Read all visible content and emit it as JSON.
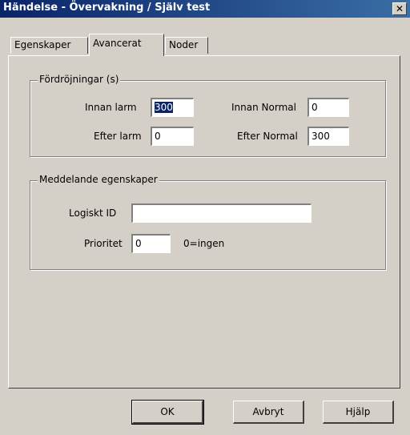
{
  "window": {
    "title": "Händelse - Övervakning / Själv test",
    "close_glyph": "✕"
  },
  "tabs": [
    {
      "label": "Egenskaper"
    },
    {
      "label": "Avancerat",
      "active": true
    },
    {
      "label": "Noder"
    }
  ],
  "delays": {
    "title": "Fördröjningar (s)",
    "before_alarm_label": "Innan larm",
    "before_alarm_value": "300",
    "after_alarm_label": "Efter larm",
    "after_alarm_value": "0",
    "before_normal_label": "Innan Normal",
    "before_normal_value": "0",
    "after_normal_label": "Efter Normal",
    "after_normal_value": "300"
  },
  "message": {
    "title": "Meddelande egenskaper",
    "logical_id_label": "Logiskt ID",
    "logical_id_value": "",
    "priority_label": "Prioritet",
    "priority_value": "0",
    "priority_hint": "0=ingen"
  },
  "buttons": {
    "ok": "OK",
    "cancel": "Avbryt",
    "help": "Hjälp"
  }
}
